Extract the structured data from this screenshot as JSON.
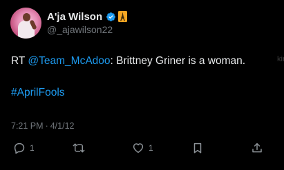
{
  "author": {
    "display_name": "A'ja Wilson",
    "handle": "@_ajawilson22",
    "verified": true,
    "name_emoji": "eiffel-tower"
  },
  "tweet": {
    "prefix": "RT ",
    "mention": "@Team_McAdoo",
    "body": ": Brittney Griner is a woman.",
    "hashtag": "#AprilFools"
  },
  "timestamp": {
    "time": "7:21 PM",
    "separator": "·",
    "date": "4/1/12"
  },
  "actions": {
    "reply_count": "1",
    "like_count": "1"
  },
  "edge_text": "kin",
  "colors": {
    "background": "#000000",
    "text": "#e7e9ea",
    "muted": "#71767b",
    "link": "#1d9bf0",
    "verified_badge": "#1d9bf0",
    "tower_emoji": "#f5a623"
  }
}
